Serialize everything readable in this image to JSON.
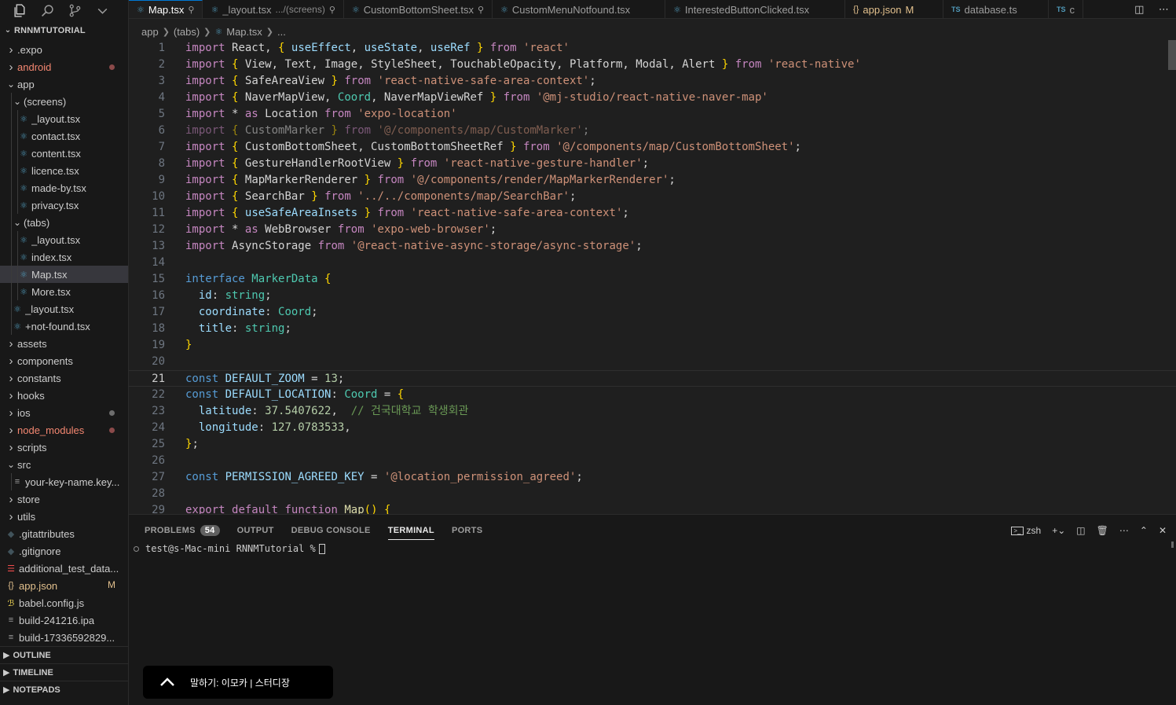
{
  "explorer": {
    "title": "RNNMTUTORIAL",
    "items": [
      {
        "label": ".expo",
        "kind": "folder",
        "open": false
      },
      {
        "label": "android",
        "kind": "folder",
        "open": false,
        "status": "dot"
      },
      {
        "label": "app",
        "kind": "folder",
        "open": true
      },
      {
        "label": "(screens)",
        "kind": "folder",
        "open": true
      },
      {
        "label": "_layout.tsx",
        "kind": "file"
      },
      {
        "label": "contact.tsx",
        "kind": "file"
      },
      {
        "label": "content.tsx",
        "kind": "file"
      },
      {
        "label": "licence.tsx",
        "kind": "file"
      },
      {
        "label": "made-by.tsx",
        "kind": "file"
      },
      {
        "label": "privacy.tsx",
        "kind": "file"
      },
      {
        "label": "(tabs)",
        "kind": "folder",
        "open": true
      },
      {
        "label": "_layout.tsx",
        "kind": "file"
      },
      {
        "label": "index.tsx",
        "kind": "file"
      },
      {
        "label": "Map.tsx",
        "kind": "file",
        "selected": true
      },
      {
        "label": "More.tsx",
        "kind": "file"
      },
      {
        "label": "_layout.tsx",
        "kind": "file"
      },
      {
        "label": "+not-found.tsx",
        "kind": "file"
      },
      {
        "label": "assets",
        "kind": "folder",
        "open": false
      },
      {
        "label": "components",
        "kind": "folder",
        "open": false
      },
      {
        "label": "constants",
        "kind": "folder",
        "open": false
      },
      {
        "label": "hooks",
        "kind": "folder",
        "open": false
      },
      {
        "label": "ios",
        "kind": "folder",
        "open": false,
        "status": "dot-grey"
      },
      {
        "label": "node_modules",
        "kind": "folder",
        "open": false,
        "status": "dot"
      },
      {
        "label": "scripts",
        "kind": "folder",
        "open": false
      },
      {
        "label": "src",
        "kind": "folder",
        "open": true
      },
      {
        "label": "your-key-name.key...",
        "kind": "file"
      },
      {
        "label": "store",
        "kind": "folder",
        "open": false
      },
      {
        "label": "utils",
        "kind": "folder",
        "open": false
      },
      {
        "label": ".gitattributes",
        "kind": "file"
      },
      {
        "label": ".gitignore",
        "kind": "file"
      },
      {
        "label": "additional_test_data...",
        "kind": "file"
      },
      {
        "label": "app.json",
        "kind": "file",
        "status": "M"
      },
      {
        "label": "babel.config.js",
        "kind": "file"
      },
      {
        "label": "build-241216.ipa",
        "kind": "file"
      },
      {
        "label": "build-17336592829...",
        "kind": "file"
      }
    ],
    "sections": [
      "OUTLINE",
      "TIMELINE",
      "NOTEPADS"
    ]
  },
  "tabs": [
    {
      "label": "Map.tsx",
      "active": true
    },
    {
      "label": "_layout.tsx",
      "sub": ".../(screens)"
    },
    {
      "label": "CustomBottomSheet.tsx"
    },
    {
      "label": "CustomMenuNotfound.tsx"
    },
    {
      "label": "InterestedButtonClicked.tsx"
    },
    {
      "label": "app.json",
      "status": "M"
    },
    {
      "label": "database.ts"
    },
    {
      "label": "c"
    }
  ],
  "breadcrumb": [
    "app",
    "(tabs)",
    "Map.tsx",
    "..."
  ],
  "editor": {
    "current_line": 21,
    "line_numbers": [
      "1",
      "2",
      "3",
      "4",
      "5",
      "6",
      "7",
      "8",
      "9",
      "10",
      "11",
      "12",
      "13",
      "14",
      "15",
      "16",
      "17",
      "18",
      "19",
      "20",
      "21",
      "22",
      "23",
      "24",
      "25",
      "26",
      "27",
      "28",
      "29"
    ],
    "lines": [
      "import React, { useEffect, useState, useRef } from 'react'",
      "import { View, Text, Image, StyleSheet, TouchableOpacity, Platform, Modal, Alert } from 'react-native'",
      "import { SafeAreaView } from 'react-native-safe-area-context';",
      "import { NaverMapView, Coord, NaverMapViewRef } from '@mj-studio/react-native-naver-map'",
      "import * as Location from 'expo-location'",
      "import { CustomMarker } from '@/components/map/CustomMarker';",
      "import { CustomBottomSheet, CustomBottomSheetRef } from '@/components/map/CustomBottomSheet';",
      "import { GestureHandlerRootView } from 'react-native-gesture-handler';",
      "import { MapMarkerRenderer } from '@/components/render/MapMarkerRenderer';",
      "import { SearchBar } from '../../components/map/SearchBar';",
      "import { useSafeAreaInsets } from 'react-native-safe-area-context';",
      "import * as WebBrowser from 'expo-web-browser';",
      "import AsyncStorage from '@react-native-async-storage/async-storage';",
      "",
      "interface MarkerData {",
      "  id: string;",
      "  coordinate: Coord;",
      "  title: string;",
      "}",
      "",
      "const DEFAULT_ZOOM = 13;",
      "const DEFAULT_LOCATION: Coord = {",
      "  latitude: 37.5407622,  // 건국대학교 학생회관",
      "  longitude: 127.0783533,",
      "};",
      "",
      "const PERMISSION_AGREED_KEY = '@location_permission_agreed';",
      "",
      "export default function Map() {"
    ]
  },
  "panel": {
    "tabs": [
      {
        "label": "PROBLEMS",
        "badge": "54"
      },
      {
        "label": "OUTPUT"
      },
      {
        "label": "DEBUG CONSOLE"
      },
      {
        "label": "TERMINAL",
        "active": true
      },
      {
        "label": "PORTS"
      }
    ],
    "shell": "zsh",
    "prompt": "test@s-Mac-mini RNNMTutorial %"
  },
  "toast": {
    "text": "말하기: 이모카 | 스터디장"
  },
  "colors": {
    "accent": "#0078d4",
    "modified": "#e2c08d",
    "error": "#f48771"
  }
}
